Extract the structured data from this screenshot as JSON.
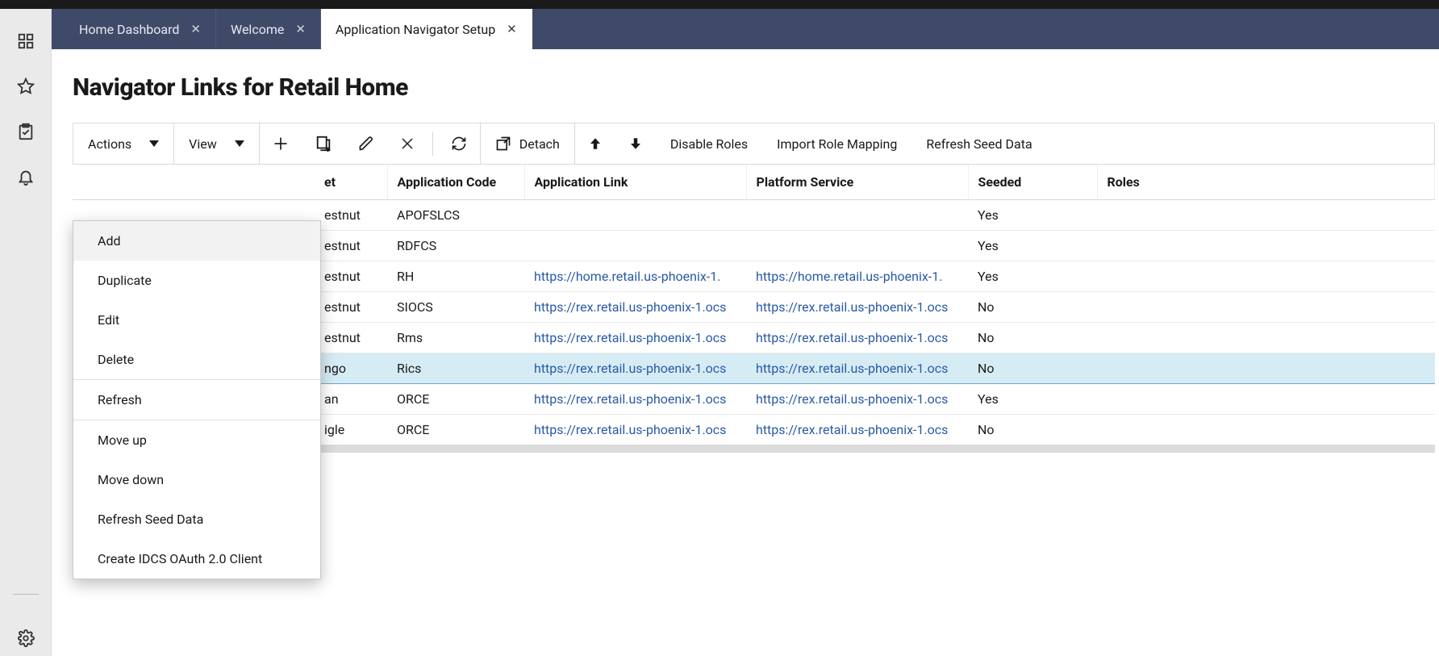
{
  "tabs": [
    {
      "label": "Home Dashboard",
      "active": false
    },
    {
      "label": "Welcome",
      "active": false
    },
    {
      "label": "Application Navigator Setup",
      "active": true
    }
  ],
  "page": {
    "title": "Navigator Links for Retail Home"
  },
  "toolbar": {
    "actions_label": "Actions",
    "view_label": "View",
    "detach_label": "Detach",
    "disable_roles_label": "Disable Roles",
    "import_role_mapping_label": "Import Role Mapping",
    "refresh_seed_data_label": "Refresh Seed Data"
  },
  "actions_menu": {
    "items": [
      "Add",
      "Duplicate",
      "Edit",
      "Delete",
      "__divider__",
      "Refresh",
      "__divider__",
      "Move up",
      "Move down",
      "Refresh Seed Data",
      "Create IDCS OAuth 2.0 Client"
    ],
    "highlight_index": 0
  },
  "table": {
    "headers": {
      "iconset": "et",
      "appcode": "Application Code",
      "applink": "Application Link",
      "platform": "Platform Service",
      "seeded": "Seeded",
      "roles": "Roles"
    },
    "rows": [
      {
        "iconset": "estnut",
        "appcode": "APOFSLCS",
        "applink": "",
        "platform": "",
        "seeded": "Yes",
        "roles": "",
        "selected": false
      },
      {
        "iconset": "estnut",
        "appcode": "RDFCS",
        "applink": "",
        "platform": "",
        "seeded": "Yes",
        "roles": "",
        "selected": false
      },
      {
        "iconset": "estnut",
        "appcode": "RH",
        "applink": "https://home.retail.us-phoenix-1.",
        "platform": "https://home.retail.us-phoenix-1.",
        "seeded": "Yes",
        "roles": "",
        "selected": false
      },
      {
        "iconset": "estnut",
        "appcode": "SIOCS",
        "applink": "https://rex.retail.us-phoenix-1.ocs",
        "platform": "https://rex.retail.us-phoenix-1.ocs",
        "seeded": "No",
        "roles": "",
        "selected": false
      },
      {
        "iconset": "estnut",
        "appcode": "Rms",
        "applink": "https://rex.retail.us-phoenix-1.ocs",
        "platform": "https://rex.retail.us-phoenix-1.ocs",
        "seeded": "No",
        "roles": "",
        "selected": false
      },
      {
        "iconset": "ngo",
        "appcode": "Rics",
        "applink": "https://rex.retail.us-phoenix-1.ocs",
        "platform": "https://rex.retail.us-phoenix-1.ocs",
        "seeded": "No",
        "roles": "",
        "selected": true
      },
      {
        "iconset": "an",
        "appcode": "ORCE",
        "applink": "https://rex.retail.us-phoenix-1.ocs",
        "platform": "https://rex.retail.us-phoenix-1.ocs",
        "seeded": "Yes",
        "roles": "",
        "selected": false
      },
      {
        "iconset": "igle",
        "appcode": "ORCE",
        "applink": "https://rex.retail.us-phoenix-1.ocs",
        "platform": "https://rex.retail.us-phoenix-1.ocs",
        "seeded": "No",
        "roles": "",
        "selected": false
      }
    ]
  }
}
